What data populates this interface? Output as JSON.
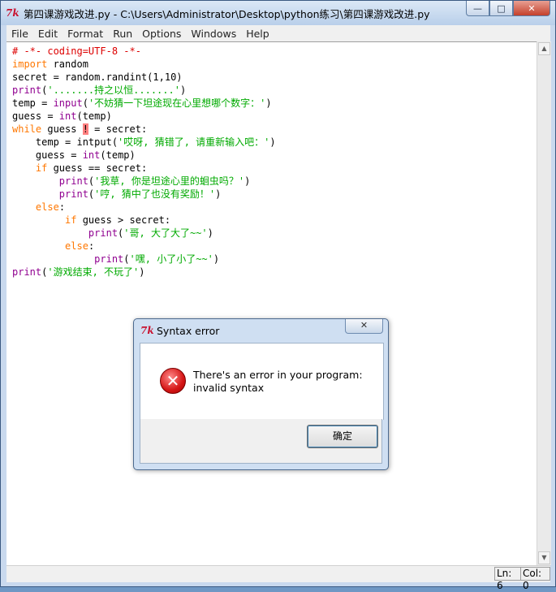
{
  "window": {
    "title": "第四课游戏改进.py - C:\\Users\\Administrator\\Desktop\\python练习\\第四课游戏改进.py",
    "app_icon": "tk-feather-icon",
    "controls": {
      "minimize": "—",
      "maximize": "□",
      "close": "✕"
    }
  },
  "menu": {
    "items": [
      "File",
      "Edit",
      "Format",
      "Run",
      "Options",
      "Windows",
      "Help"
    ]
  },
  "editor": {
    "lines": [
      [
        {
          "t": "# -*- coding=UTF-8 -*-",
          "c": "cm"
        }
      ],
      [
        {
          "t": "import",
          "c": "kw"
        },
        {
          "t": " random",
          "c": "df"
        }
      ],
      [
        {
          "t": "secret = random.randint(1,10)",
          "c": "df"
        }
      ],
      [
        {
          "t": "print",
          "c": "bi"
        },
        {
          "t": "(",
          "c": "df"
        },
        {
          "t": "'.......持之以恒.......'",
          "c": "str"
        },
        {
          "t": ")",
          "c": "df"
        }
      ],
      [
        {
          "t": "temp = ",
          "c": "df"
        },
        {
          "t": "input",
          "c": "bi"
        },
        {
          "t": "(",
          "c": "df"
        },
        {
          "t": "'不妨猜一下坦途现在心里想哪个数字：'",
          "c": "str"
        },
        {
          "t": ")",
          "c": "df"
        }
      ],
      [
        {
          "t": "guess = ",
          "c": "df"
        },
        {
          "t": "int",
          "c": "bi"
        },
        {
          "t": "(temp)",
          "c": "df"
        }
      ],
      [
        {
          "t": "while",
          "c": "kw"
        },
        {
          "t": " guess ",
          "c": "df"
        },
        {
          "t": "!",
          "c": "errmark"
        },
        {
          "t": " = secret:",
          "c": "df"
        }
      ],
      [
        {
          "t": "    temp = intput(",
          "c": "df"
        },
        {
          "t": "'哎呀, 猜错了, 请重新输入吧：'",
          "c": "str"
        },
        {
          "t": ")",
          "c": "df"
        }
      ],
      [
        {
          "t": "    guess = ",
          "c": "df"
        },
        {
          "t": "int",
          "c": "bi"
        },
        {
          "t": "(temp)",
          "c": "df"
        }
      ],
      [
        {
          "t": "    ",
          "c": "df"
        },
        {
          "t": "if",
          "c": "kw"
        },
        {
          "t": " guess == secret:",
          "c": "df"
        }
      ],
      [
        {
          "t": "        ",
          "c": "df"
        },
        {
          "t": "print",
          "c": "bi"
        },
        {
          "t": "(",
          "c": "df"
        },
        {
          "t": "'我草, 你是坦途心里的蛔虫吗？'",
          "c": "str"
        },
        {
          "t": ")",
          "c": "df"
        }
      ],
      [
        {
          "t": "        ",
          "c": "df"
        },
        {
          "t": "print",
          "c": "bi"
        },
        {
          "t": "(",
          "c": "df"
        },
        {
          "t": "'哼, 猜中了也没有奖励！'",
          "c": "str"
        },
        {
          "t": ")",
          "c": "df"
        }
      ],
      [
        {
          "t": "    ",
          "c": "df"
        },
        {
          "t": "else",
          "c": "kw"
        },
        {
          "t": ":",
          "c": "df"
        }
      ],
      [
        {
          "t": "         ",
          "c": "df"
        },
        {
          "t": "if",
          "c": "kw"
        },
        {
          "t": " guess > secret:",
          "c": "df"
        }
      ],
      [
        {
          "t": "             ",
          "c": "df"
        },
        {
          "t": "print",
          "c": "bi"
        },
        {
          "t": "(",
          "c": "df"
        },
        {
          "t": "'哥, 大了大了~~'",
          "c": "str"
        },
        {
          "t": ")",
          "c": "df"
        }
      ],
      [
        {
          "t": "         ",
          "c": "df"
        },
        {
          "t": "else",
          "c": "kw"
        },
        {
          "t": ":",
          "c": "df"
        }
      ],
      [
        {
          "t": "              ",
          "c": "df"
        },
        {
          "t": "print",
          "c": "bi"
        },
        {
          "t": "(",
          "c": "df"
        },
        {
          "t": "'嘿, 小了小了~~'",
          "c": "str"
        },
        {
          "t": ")",
          "c": "df"
        }
      ],
      [
        {
          "t": "print",
          "c": "bi"
        },
        {
          "t": "(",
          "c": "df"
        },
        {
          "t": "'游戏结束, 不玩了'",
          "c": "str"
        },
        {
          "t": ")",
          "c": "df"
        }
      ]
    ]
  },
  "status": {
    "line": "Ln: 6",
    "col": "Col: 0"
  },
  "dialog": {
    "title": "Syntax error",
    "message_line1": "There's an error in your program:",
    "message_line2": "invalid syntax",
    "ok_label": "确定",
    "close": "✕",
    "icon": "error-icon"
  },
  "colors": {
    "keyword": "#ff7700",
    "builtin": "#900090",
    "string": "#00aa00",
    "comment": "#dd0000",
    "error_highlight": "#ff8080"
  }
}
